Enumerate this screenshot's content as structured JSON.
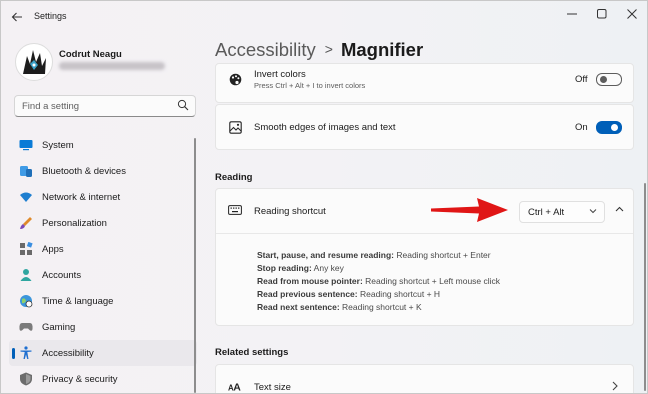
{
  "titlebar": {
    "app_title": "Settings",
    "icons": {
      "back": "back-arrow-icon",
      "minimize": "minimize-icon",
      "maximize": "maximize-icon",
      "close": "close-icon"
    }
  },
  "profile": {
    "name": "Codrut Neagu"
  },
  "search": {
    "placeholder": "Find a setting"
  },
  "sidebar": {
    "items": [
      {
        "label": "System",
        "icon": "system-icon"
      },
      {
        "label": "Bluetooth & devices",
        "icon": "bluetooth-icon"
      },
      {
        "label": "Network & internet",
        "icon": "wifi-icon"
      },
      {
        "label": "Personalization",
        "icon": "paintbrush-icon"
      },
      {
        "label": "Apps",
        "icon": "apps-icon"
      },
      {
        "label": "Accounts",
        "icon": "person-icon"
      },
      {
        "label": "Time & language",
        "icon": "globe-icon"
      },
      {
        "label": "Gaming",
        "icon": "gamepad-icon"
      },
      {
        "label": "Accessibility",
        "icon": "accessibility-icon",
        "active": true
      },
      {
        "label": "Privacy & security",
        "icon": "shield-icon"
      }
    ]
  },
  "breadcrumb": {
    "parent": "Accessibility",
    "separator": ">",
    "current": "Magnifier"
  },
  "settings": {
    "invert_colors": {
      "title": "Invert colors",
      "subtitle": "Press Ctrl + Alt + I to invert colors",
      "state_label": "Off",
      "on": false,
      "icon": "palette-icon"
    },
    "smooth_edges": {
      "title": "Smooth edges of images and text",
      "state_label": "On",
      "on": true,
      "icon": "image-icon"
    }
  },
  "reading": {
    "section_title": "Reading",
    "shortcut": {
      "title": "Reading shortcut",
      "value": "Ctrl + Alt",
      "icon": "keyboard-icon"
    },
    "details": [
      {
        "key": "Start, pause, and resume reading:",
        "value": " Reading shortcut + Enter"
      },
      {
        "key": "Stop reading:",
        "value": " Any key"
      },
      {
        "key": "Read from mouse pointer:",
        "value": " Reading shortcut + Left mouse click"
      },
      {
        "key": "Read previous sentence:",
        "value": " Reading shortcut + H"
      },
      {
        "key": "Read next sentence:",
        "value": " Reading shortcut + K"
      }
    ]
  },
  "related": {
    "section_title": "Related settings",
    "text_size": {
      "title": "Text size",
      "icon": "text-size-icon"
    }
  },
  "colors": {
    "accent": "#005fb8",
    "annotation_arrow": "#e01515"
  }
}
